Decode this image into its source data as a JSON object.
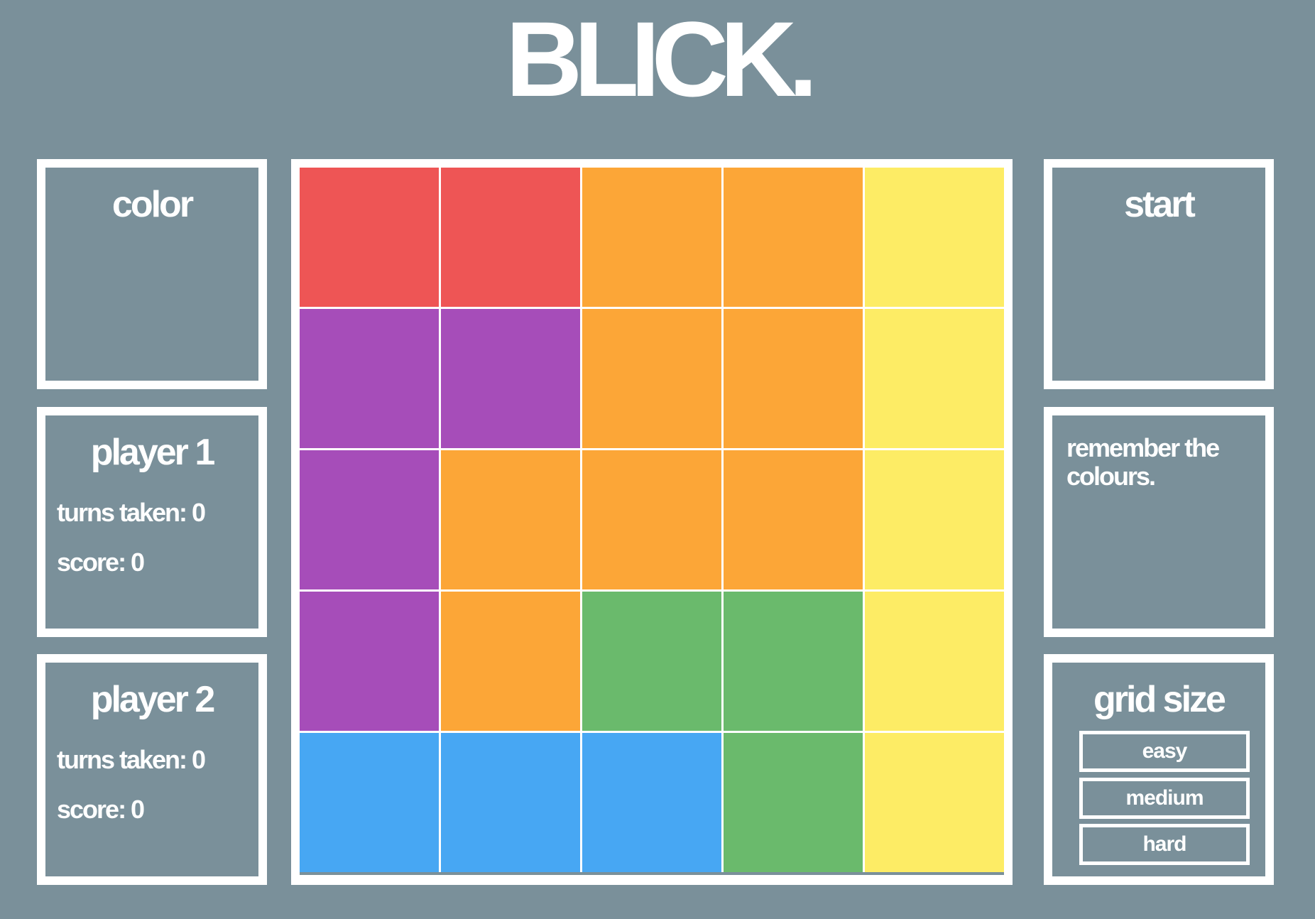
{
  "title": "BLICK.",
  "left_panels": {
    "color": {
      "heading": "color"
    },
    "player1": {
      "heading": "player 1",
      "turns_taken": "turns taken: 0",
      "score": "score: 0"
    },
    "player2": {
      "heading": "player 2",
      "turns_taken": "turns taken: 0",
      "score": "score: 0"
    }
  },
  "right_panels": {
    "start": {
      "heading": "start"
    },
    "message": {
      "text": "remember the colours."
    },
    "grid_size": {
      "heading": "grid size",
      "options": [
        "easy",
        "medium",
        "hard"
      ]
    }
  },
  "board": {
    "rows": 5,
    "cols": 5,
    "colors": {
      "red": "#ee5555",
      "orange": "#fca637",
      "yellow": "#fdec65",
      "purple": "#a64db9",
      "green": "#6aba6c",
      "blue": "#47a7f3"
    },
    "cells": [
      [
        "red",
        "red",
        "orange",
        "orange",
        "yellow"
      ],
      [
        "purple",
        "purple",
        "orange",
        "orange",
        "yellow"
      ],
      [
        "purple",
        "orange",
        "orange",
        "orange",
        "yellow"
      ],
      [
        "purple",
        "orange",
        "green",
        "green",
        "yellow"
      ],
      [
        "blue",
        "blue",
        "blue",
        "green",
        "yellow"
      ]
    ]
  }
}
